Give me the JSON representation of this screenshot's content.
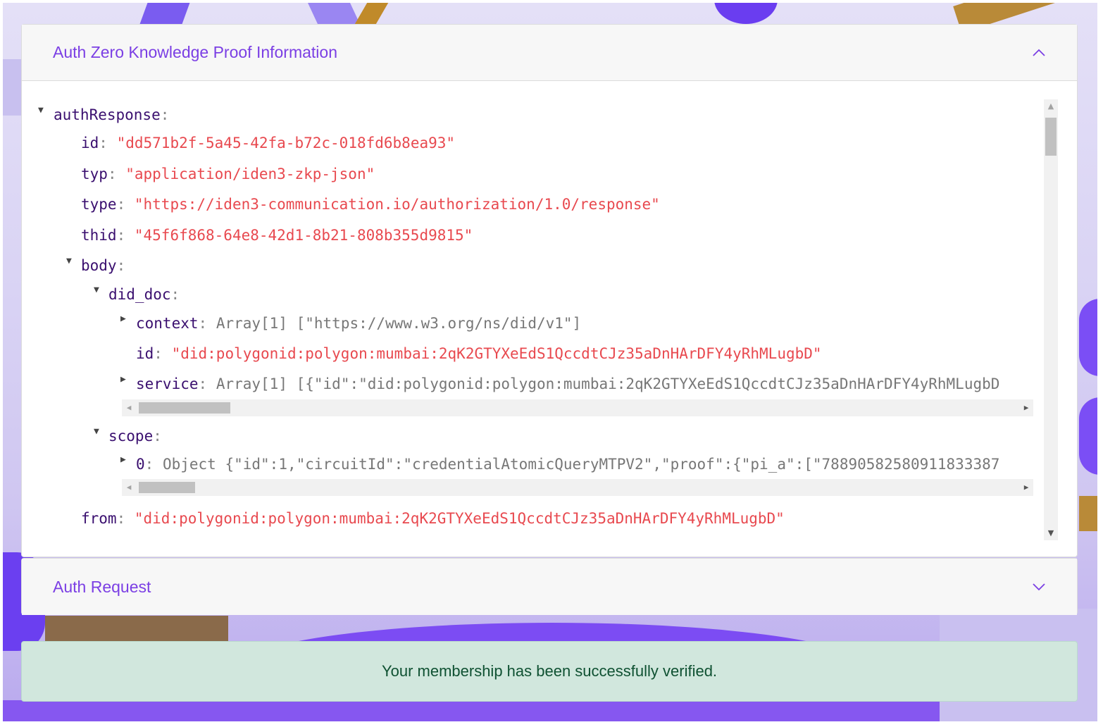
{
  "panels": {
    "zkp": {
      "title": "Auth Zero Knowledge Proof Information",
      "expanded": true
    },
    "request": {
      "title": "Auth Request",
      "expanded": false
    }
  },
  "json": {
    "authResponse": {
      "key": "authResponse"
    },
    "id": {
      "key": "id",
      "value": "\"dd571b2f-5a45-42fa-b72c-018fd6b8ea93\""
    },
    "typ": {
      "key": "typ",
      "value": "\"application/iden3-zkp-json\""
    },
    "type": {
      "key": "type",
      "value": "\"https://iden3-communication.io/authorization/1.0/response\""
    },
    "thid": {
      "key": "thid",
      "value": "\"45f6f868-64e8-42d1-8b21-808b355d9815\""
    },
    "body": {
      "key": "body"
    },
    "did_doc": {
      "key": "did_doc"
    },
    "context": {
      "key": "context",
      "value": "Array[1] [\"https://www.w3.org/ns/did/v1\"]"
    },
    "did_id": {
      "key": "id",
      "value": "\"did:polygonid:polygon:mumbai:2qK2GTYXeEdS1QccdtCJz35aDnHArDFY4yRhMLugbD\""
    },
    "service": {
      "key": "service",
      "value": "Array[1] [{\"id\":\"did:polygonid:polygon:mumbai:2qK2GTYXeEdS1QccdtCJz35aDnHArDFY4yRhMLugbD"
    },
    "scope": {
      "key": "scope"
    },
    "scope0": {
      "key": "0",
      "value": "Object {\"id\":1,\"circuitId\":\"credentialAtomicQueryMTPV2\",\"proof\":{\"pi_a\":[\"78890582580911833387"
    },
    "from": {
      "key": "from",
      "value": "\"did:polygonid:polygon:mumbai:2qK2GTYXeEdS1QccdtCJz35aDnHArDFY4yRhMLugbD\""
    }
  },
  "icons": {
    "expanded": "triangle-down-icon",
    "collapsed": "triangle-right-icon"
  },
  "alert": {
    "message": "Your membership has been successfully verified."
  },
  "colors": {
    "accent": "#7b3fe4",
    "key": "#3a0f6f",
    "string": "#e8494f",
    "success_bg": "#d1e7dd",
    "success_text": "#0f5132"
  }
}
